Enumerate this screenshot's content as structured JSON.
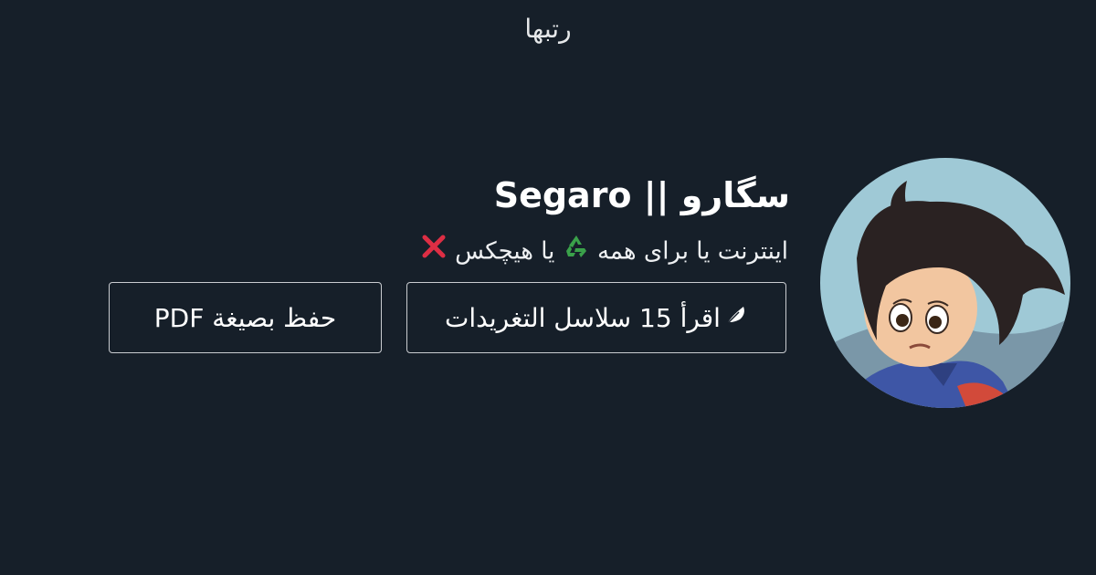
{
  "brand": {
    "name": "رتبها"
  },
  "profile": {
    "name": "سگارو || Segaro",
    "bio_text_1": "اینترنت یا برای همه",
    "bio_text_2": "یا هیچکس",
    "bio_icons": [
      "recycle-icon",
      "cross-mark-icon"
    ]
  },
  "actions": {
    "read_label": "اقرأ 15 سلاسل التغريدات",
    "read_icon": "feather-icon",
    "pdf_label": "حفظ بصيغة PDF"
  },
  "colors": {
    "background": "#161f29",
    "text": "#ffffff",
    "button_border": "#c9ccd0",
    "recycle": "#3aa14a",
    "cross": "#dd2e44"
  }
}
